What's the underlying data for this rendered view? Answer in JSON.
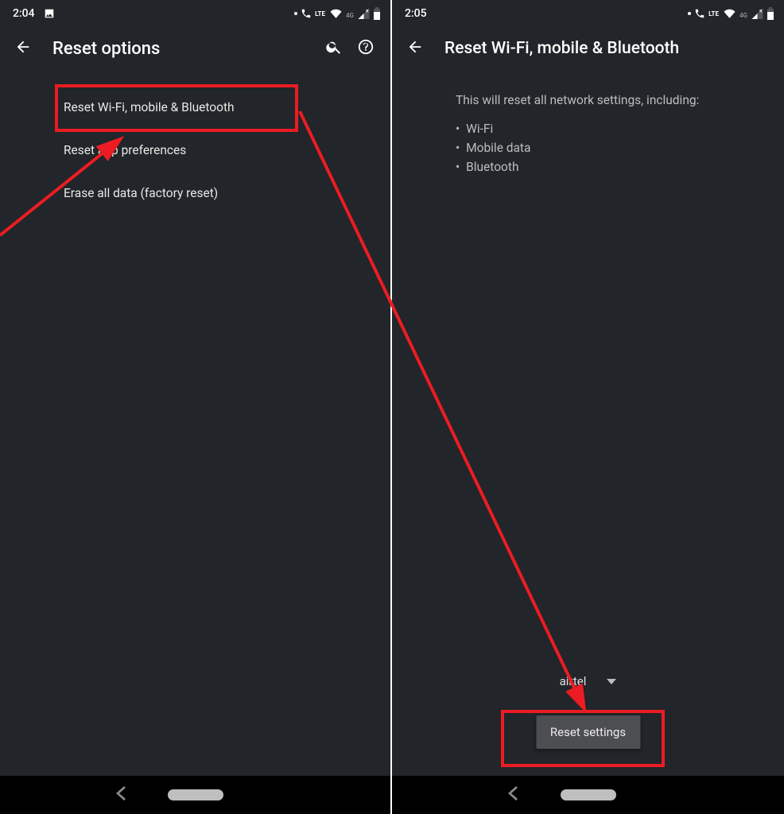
{
  "left": {
    "status_time": "2:04",
    "lte_label": "LTE",
    "fourg_label": "4G",
    "header_title": "Reset options",
    "items": [
      {
        "label": "Reset Wi-Fi, mobile & Bluetooth"
      },
      {
        "label": "Reset app preferences"
      },
      {
        "label": "Erase all data (factory reset)"
      }
    ]
  },
  "right": {
    "status_time": "2:05",
    "lte_label": "LTE",
    "fourg_label": "4G",
    "header_title": "Reset Wi-Fi, mobile & Bluetooth",
    "lead_text": "This will reset all network settings, including:",
    "bullets": [
      "Wi-Fi",
      "Mobile data",
      "Bluetooth"
    ],
    "sim_selected": "airtel",
    "reset_button_label": "Reset settings"
  }
}
